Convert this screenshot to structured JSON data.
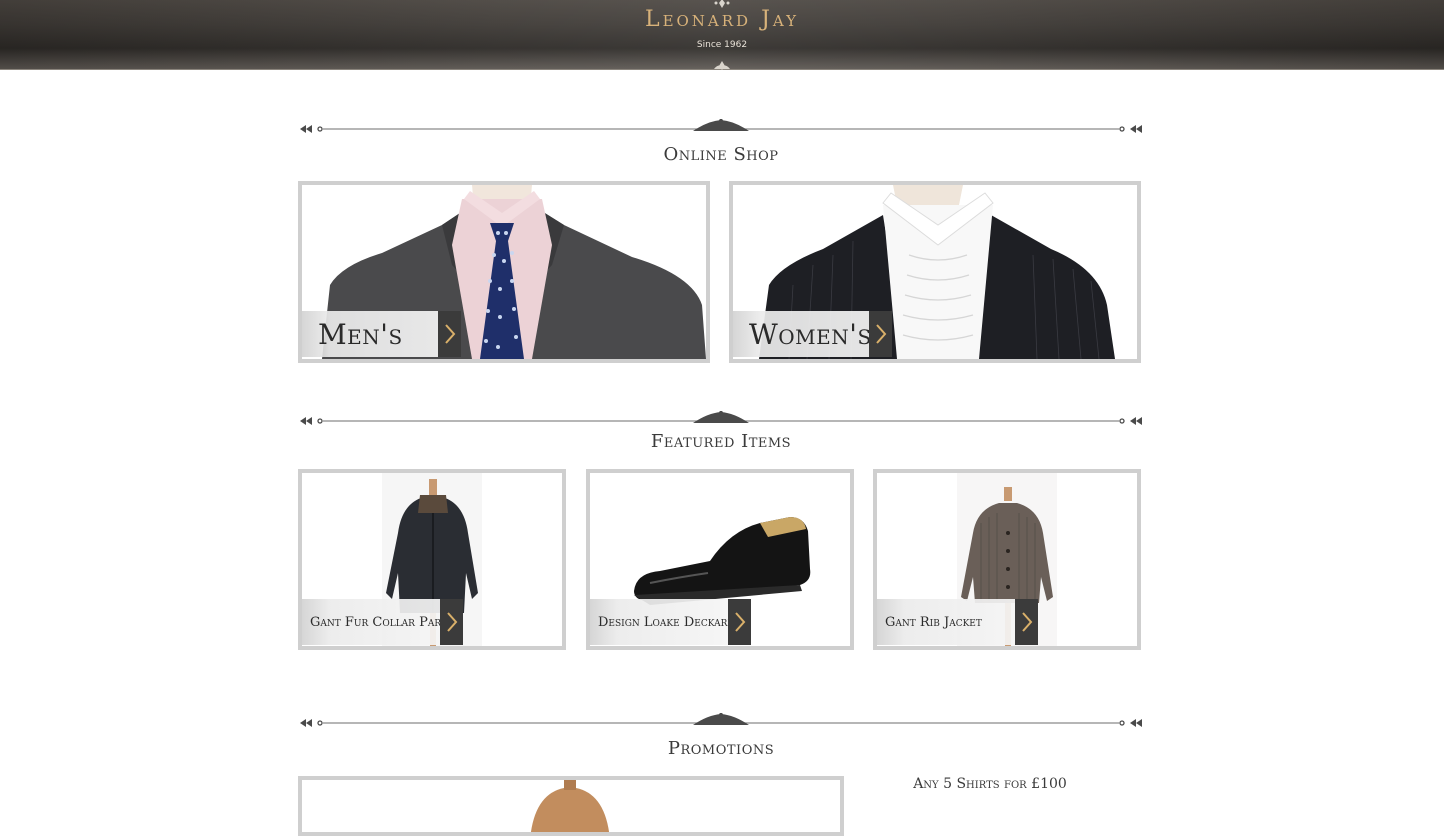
{
  "brand": {
    "name": "Leonard Jay",
    "tagline": "Since 1962"
  },
  "sections": {
    "online_shop": "Online Shop",
    "featured_items": "Featured Items",
    "promotions": "Promotions"
  },
  "categories": [
    {
      "label": "Men's"
    },
    {
      "label": "Women's"
    }
  ],
  "featured": [
    {
      "label": "Gant Fur Collar Parka"
    },
    {
      "label": "Design Loake Deckard"
    },
    {
      "label": "Gant Rib Jacket"
    }
  ],
  "promotion": {
    "text": "Any 5 Shirts for £100"
  },
  "colors": {
    "header_bg": "#3d3935",
    "logo_gold": "#d8b27a",
    "card_border": "#cfcfcf",
    "arrow_bg": "#3b3b3b",
    "arrow_gold": "#d9b06a"
  },
  "icons": {
    "arrow": "chevron-right-icon",
    "divider": "ornament-divider"
  }
}
